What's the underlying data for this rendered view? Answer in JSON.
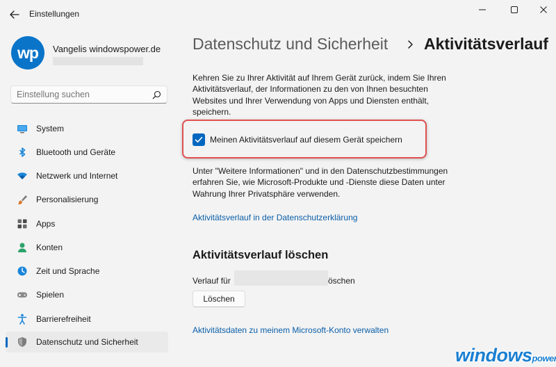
{
  "window": {
    "title": "Einstellungen",
    "icons": {
      "back": "back-arrow-icon",
      "minimize": "minimize-icon",
      "maximize": "maximize-icon",
      "close": "close-icon"
    }
  },
  "profile": {
    "avatar_text": "wp",
    "name": "Vangelis windowspower.de"
  },
  "search": {
    "placeholder": "Einstellung suchen",
    "icon": "search-icon"
  },
  "sidebar": {
    "items": [
      {
        "label": "System",
        "icon": "monitor-icon"
      },
      {
        "label": "Bluetooth und Geräte",
        "icon": "bluetooth-icon"
      },
      {
        "label": "Netzwerk und Internet",
        "icon": "wifi-icon"
      },
      {
        "label": "Personalisierung",
        "icon": "brush-icon"
      },
      {
        "label": "Apps",
        "icon": "apps-grid-icon"
      },
      {
        "label": "Konten",
        "icon": "account-icon"
      },
      {
        "label": "Zeit und Sprache",
        "icon": "globe-clock-icon"
      },
      {
        "label": "Spielen",
        "icon": "gamepad-icon"
      },
      {
        "label": "Barrierefreiheit",
        "icon": "accessibility-icon"
      },
      {
        "label": "Datenschutz und Sicherheit",
        "icon": "shield-icon",
        "active": true
      }
    ]
  },
  "main": {
    "breadcrumb_parent": "Datenschutz und Sicherheit",
    "breadcrumb_separator": "chevron-right-icon",
    "title": "Aktivitätsverlauf",
    "description": "Kehren Sie zu Ihrer Aktivität auf Ihrem Gerät zurück, indem Sie Ihren Aktivitätsverlauf, der Informationen zu den von Ihnen besuchten Websites und Ihrer Verwendung von Apps und Diensten enthält, speichern.",
    "checkbox": {
      "label": "Meinen Aktivitätsverlauf auf diesem Gerät speichern",
      "checked": true
    },
    "info": "Unter \"Weitere Informationen\" und in den Datenschutzbestimmungen erfahren Sie, wie Microsoft-Produkte und -Dienste diese Daten unter Wahrung Ihrer Privatsphäre verwenden.",
    "privacy_link": "Aktivitätsverlauf in der Datenschutzerklärung",
    "clear_section": {
      "heading": "Aktivitätsverlauf löschen",
      "history_prefix": "Verlauf für",
      "history_suffix": "öschen",
      "clear_button": "Löschen"
    },
    "manage_link": "Aktivitätsdaten zu meinem Microsoft-Konto verwalten"
  },
  "watermark": {
    "main": "windows",
    "suffix": "power."
  },
  "colors": {
    "accent": "#0067c0",
    "link": "#0a5ea8",
    "highlight": "#e05050",
    "background": "#f3f3f3"
  }
}
